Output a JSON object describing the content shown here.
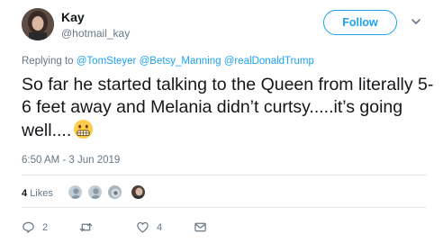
{
  "author": {
    "name": "Kay",
    "handle": "@hotmail_kay"
  },
  "follow_label": "Follow",
  "reply_prefix": "Replying to",
  "mentions": [
    "@TomSteyer",
    "@Betsy_Manning",
    "@realDonaldTrump"
  ],
  "tweet_text": "So far he started talking to the Queen from literally 5-6 feet away and Melania didn’t curtsy.....it’s going well....",
  "emoji": "grimacing-face",
  "timestamp": "6:50 AM - 3 Jun 2019",
  "likes": {
    "count": "4",
    "label": "Likes"
  },
  "actions": {
    "reply_count": "2",
    "retweet_count": "",
    "like_count": "4"
  },
  "colors": {
    "accent": "#1da1f2",
    "muted": "#657786",
    "text": "#14171a",
    "divider": "#e1e8ed"
  }
}
